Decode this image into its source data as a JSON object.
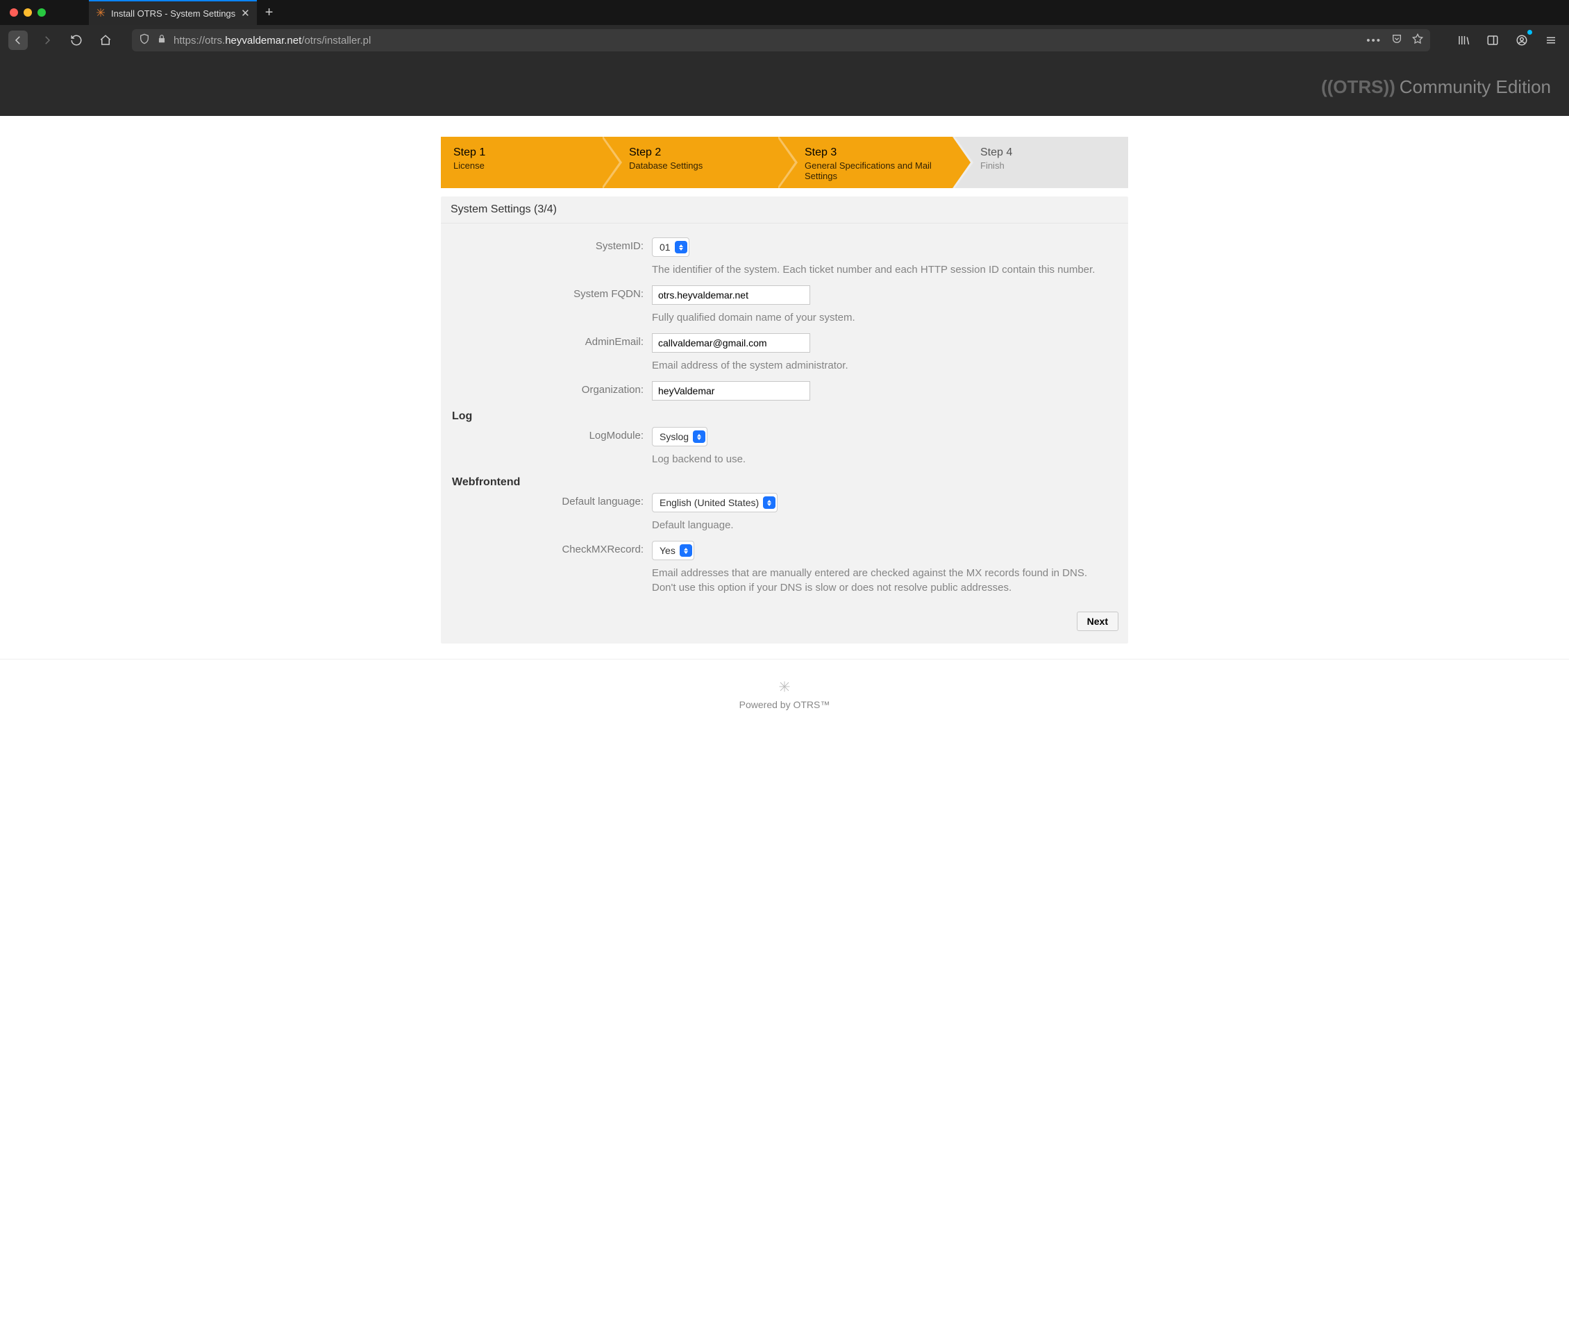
{
  "browser": {
    "tab_title": "Install OTRS - System Settings",
    "url_protocol": "https://",
    "url_sub": "otrs.",
    "url_host": "heyvaldemar.net",
    "url_path": "/otrs/installer.pl"
  },
  "header": {
    "brand": "((OTRS))",
    "edition": "Community Edition"
  },
  "stepper": [
    {
      "title": "Step 1",
      "sub": "License",
      "active": true
    },
    {
      "title": "Step 2",
      "sub": "Database Settings",
      "active": true
    },
    {
      "title": "Step 3",
      "sub": "General Specifications and Mail Settings",
      "active": true
    },
    {
      "title": "Step 4",
      "sub": "Finish",
      "active": false
    }
  ],
  "panel": {
    "title": "System Settings (3/4)"
  },
  "form": {
    "systemid_label": "SystemID:",
    "systemid_value": "01",
    "systemid_help": "The identifier of the system. Each ticket number and each HTTP session ID contain this number.",
    "fqdn_label": "System FQDN:",
    "fqdn_value": "otrs.heyvaldemar.net",
    "fqdn_help": "Fully qualified domain name of your system.",
    "admin_label": "AdminEmail:",
    "admin_value": "callvaldemar@gmail.com",
    "admin_help": "Email address of the system administrator.",
    "org_label": "Organization:",
    "org_value": "heyValdemar",
    "log_section": "Log",
    "logmodule_label": "LogModule:",
    "logmodule_value": "Syslog",
    "logmodule_help": "Log backend to use.",
    "web_section": "Webfrontend",
    "lang_label": "Default language:",
    "lang_value": "English (United States)",
    "lang_help": "Default language.",
    "mx_label": "CheckMXRecord:",
    "mx_value": "Yes",
    "mx_help": "Email addresses that are manually entered are checked against the MX records found in DNS. Don't use this option if your DNS is slow or does not resolve public addresses.",
    "next_button": "Next"
  },
  "footer": {
    "text": "Powered by OTRS™"
  }
}
